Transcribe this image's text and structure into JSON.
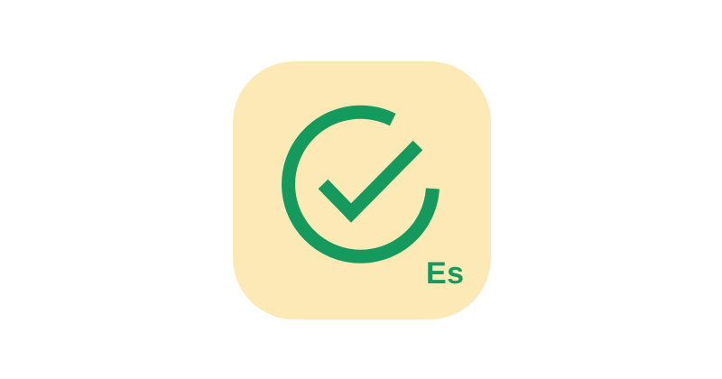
{
  "app_icon": {
    "icon_name": "checkmark-circle-icon",
    "language_badge": "Es",
    "colors": {
      "background": "#fde9b6",
      "accent": "#159a5e"
    }
  }
}
